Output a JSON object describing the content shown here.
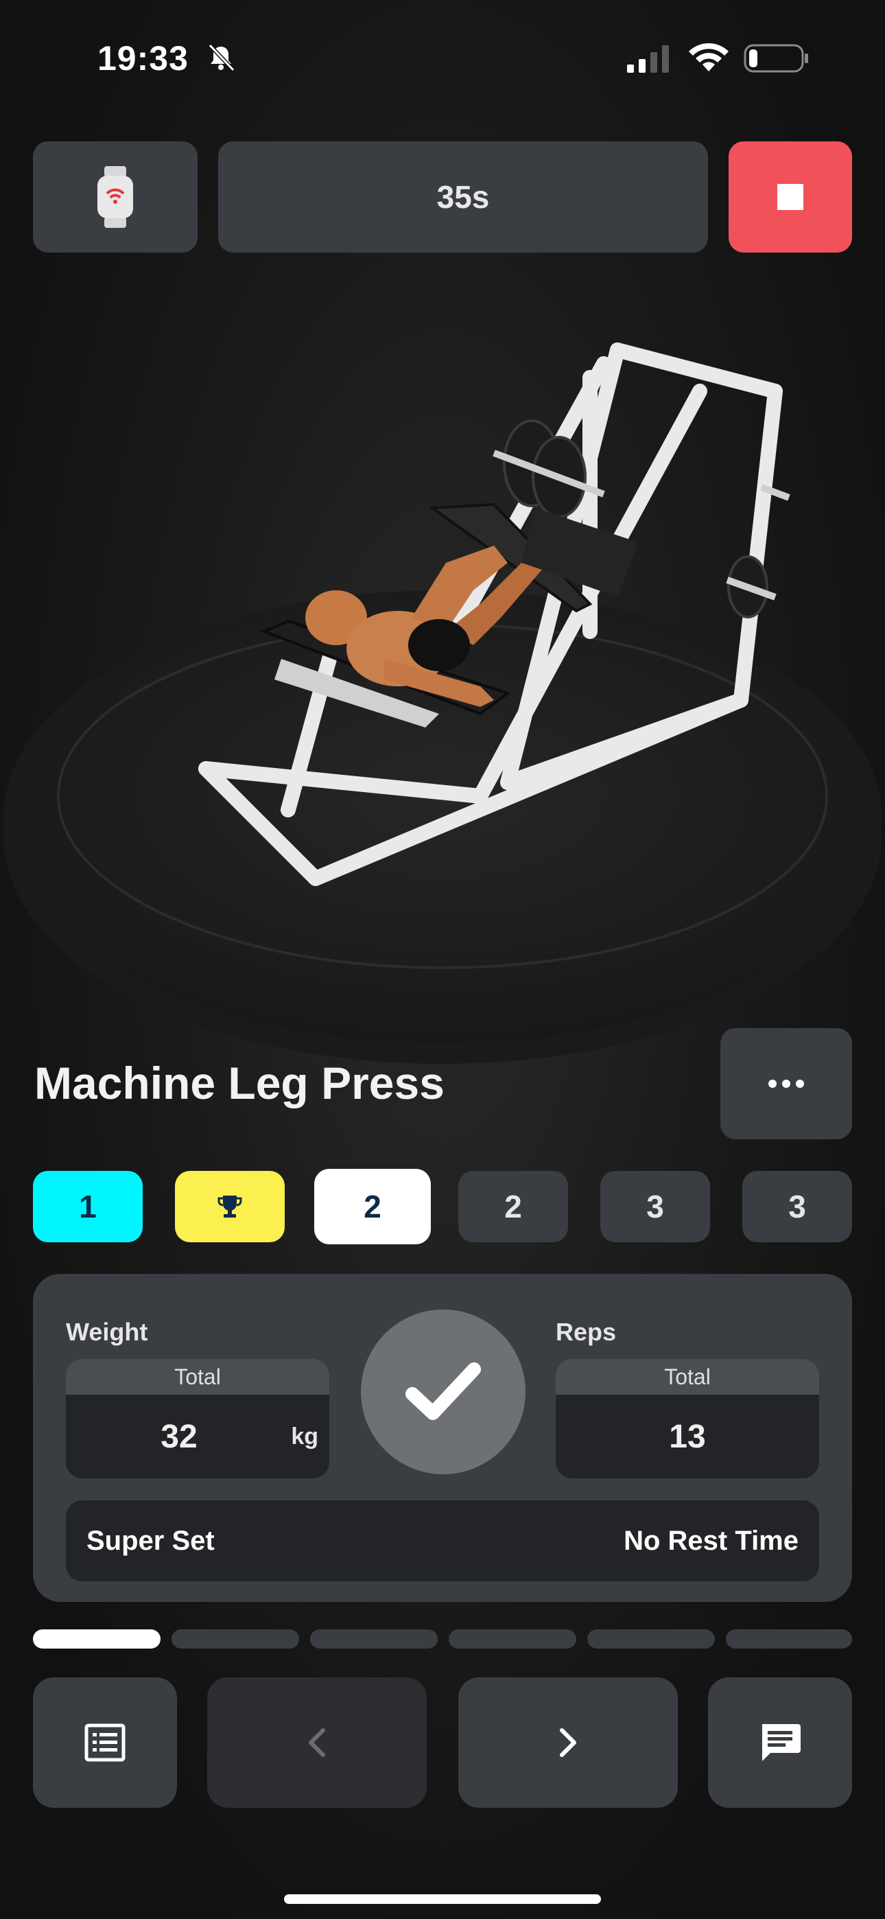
{
  "status_bar": {
    "time": "19:33",
    "icons": [
      "bell-slash-icon",
      "signal-icon",
      "wifi-icon",
      "battery-icon"
    ],
    "battery_level": 0.15
  },
  "top_controls": {
    "watch_icon": "smartwatch-icon",
    "timer_label": "35s",
    "stop_icon": "stop-icon",
    "stop_color": "#f1525a"
  },
  "exercise": {
    "name": "Machine Leg Press",
    "more_icon": "more-dots-icon"
  },
  "sets": [
    {
      "label": "1",
      "state": "completed",
      "color": "#00f5ff",
      "text_color": "#0f2a4a"
    },
    {
      "label": "",
      "icon": "trophy-icon",
      "state": "record",
      "color": "#fbf04f",
      "text_color": "#0f2a4a"
    },
    {
      "label": "2",
      "state": "active",
      "color": "#ffffff",
      "text_color": "#0f2a4a"
    },
    {
      "label": "2",
      "state": "pending",
      "color": "#3a3d42",
      "text_color": "#e6e6e6"
    },
    {
      "label": "3",
      "state": "pending",
      "color": "#3a3d42",
      "text_color": "#e6e6e6"
    },
    {
      "label": "3",
      "state": "pending",
      "color": "#3a3d42",
      "text_color": "#e6e6e6"
    }
  ],
  "set_card": {
    "weight": {
      "label": "Weight",
      "header": "Total",
      "value": "32",
      "unit": "kg"
    },
    "reps": {
      "label": "Reps",
      "header": "Total",
      "value": "13"
    },
    "check_icon": "checkmark-icon",
    "superset_label": "Super Set",
    "rest_label": "No Rest Time"
  },
  "progress": {
    "segments": 6,
    "completed": 1
  },
  "bottom_nav": {
    "list_icon": "list-icon",
    "prev_icon": "chevron-left-icon",
    "next_icon": "chevron-right-icon",
    "chat_icon": "chat-icon"
  }
}
